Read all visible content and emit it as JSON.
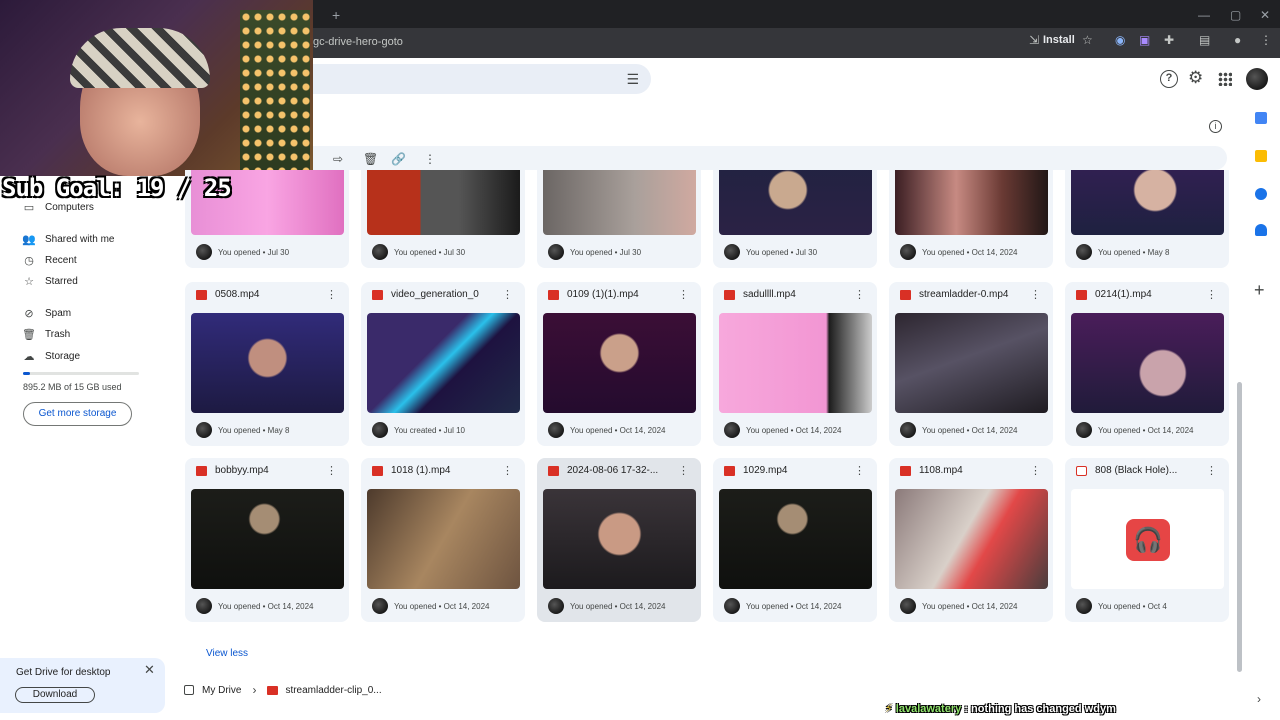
{
  "browser": {
    "url_fragment": "gc-drive-hero-goto",
    "install_label": "Install"
  },
  "overlay": {
    "sub_goal": "Sub Goal: 19 / 25"
  },
  "sidebar": {
    "items": [
      {
        "label": "Computers",
        "icon": "computer-icon"
      },
      {
        "label": "Shared with me",
        "icon": "people-icon"
      },
      {
        "label": "Recent",
        "icon": "clock-icon"
      },
      {
        "label": "Starred",
        "icon": "star-icon"
      },
      {
        "label": "Spam",
        "icon": "spam-icon"
      },
      {
        "label": "Trash",
        "icon": "trash-icon"
      },
      {
        "label": "Storage",
        "icon": "cloud-icon"
      }
    ],
    "storage_used": "895.2 MB of 15 GB used",
    "storage_fraction": 0.06,
    "get_more_storage": "Get more storage"
  },
  "files": [
    {
      "name": "",
      "meta": "You opened • Jul 30"
    },
    {
      "name": "",
      "meta": "You opened • Jul 30"
    },
    {
      "name": "",
      "meta": "You opened • Jul 30"
    },
    {
      "name": "",
      "meta": "You opened • Jul 30"
    },
    {
      "name": "",
      "meta": "You opened • Oct 14, 2024"
    },
    {
      "name": "",
      "meta": "You opened • May 8"
    },
    {
      "name": "0508.mp4",
      "meta": "You opened • May 8"
    },
    {
      "name": "video_generation_0",
      "meta": "You created • Jul 10"
    },
    {
      "name": "0109 (1)(1).mp4",
      "meta": "You opened • Oct 14, 2024"
    },
    {
      "name": "sadullll.mp4",
      "meta": "You opened • Oct 14, 2024"
    },
    {
      "name": "streamladder-0.mp4",
      "meta": "You opened • Oct 14, 2024"
    },
    {
      "name": "0214(1).mp4",
      "meta": "You opened • Oct 14, 2024"
    },
    {
      "name": "bobbyy.mp4",
      "meta": "You opened • Oct 14, 2024"
    },
    {
      "name": "1018 (1).mp4",
      "meta": "You opened • Oct 14, 2024"
    },
    {
      "name": "2024-08-06 17-32-...",
      "meta": "You opened • Oct 14, 2024"
    },
    {
      "name": "1029.mp4",
      "meta": "You opened • Oct 14, 2024"
    },
    {
      "name": "1108.mp4",
      "meta": "You opened • Oct 14, 2024"
    },
    {
      "name": "808 (Black Hole)...",
      "meta": "You opened • Oct 4"
    }
  ],
  "view_less": "View less",
  "promo": {
    "text": "Get Drive for desktop",
    "download": "Download"
  },
  "breadcrumb": {
    "root": "My Drive",
    "current": "streamladder-clip_0..."
  },
  "chat": {
    "user": "lavalawatery",
    "message": " : nothing has changed wdym"
  },
  "colors": {
    "accent": "#0b57d0",
    "video_red": "#d93025",
    "card_bg": "#f0f4f9"
  }
}
